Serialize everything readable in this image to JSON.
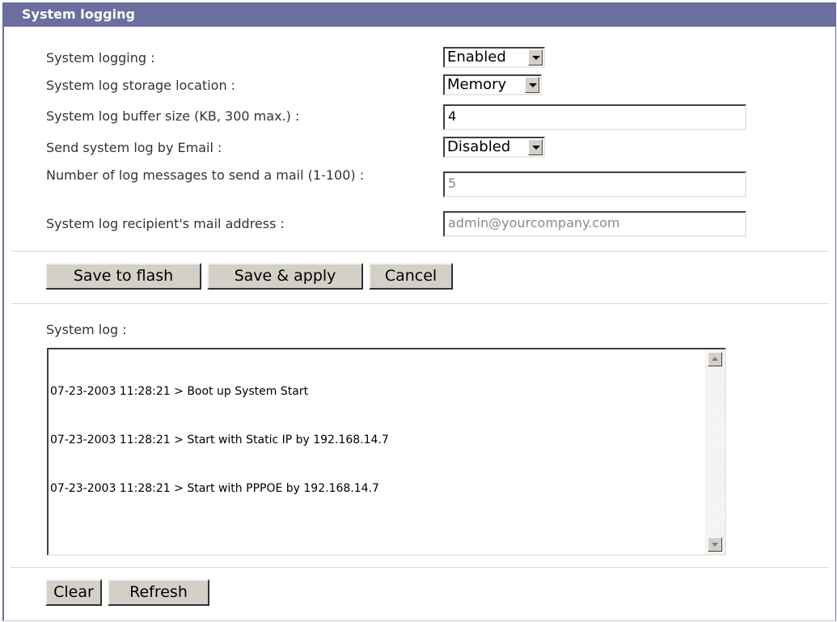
{
  "panel": {
    "title": "System logging"
  },
  "form": {
    "logging_label": "System logging :",
    "logging_value": "Enabled",
    "storage_label": "System log storage location :",
    "storage_value": "Memory",
    "buffer_label": "System log buffer size (KB, 300 max.) :",
    "buffer_value": "4",
    "email_label": "Send system log by Email :",
    "email_value": "Disabled",
    "count_label": "Number of log messages to send a mail (1-100) :",
    "count_value": "5",
    "recipient_label": "System log recipient's mail address :",
    "recipient_value": "admin@yourcompany.com"
  },
  "actions": {
    "save_flash": "Save to flash",
    "save_apply": "Save & apply",
    "cancel": "Cancel"
  },
  "log": {
    "label": "System log :",
    "lines": [
      "07-23-2003 11:28:21 > Boot up System Start",
      "07-23-2003 11:28:21 > Start with Static IP by 192.168.14.7",
      "07-23-2003 11:28:21 > Start with PPPOE by 192.168.14.7"
    ],
    "clear": "Clear",
    "refresh": "Refresh"
  },
  "colors": {
    "title_bar": "#6a6f9f",
    "button_face": "#d4d0c8"
  }
}
